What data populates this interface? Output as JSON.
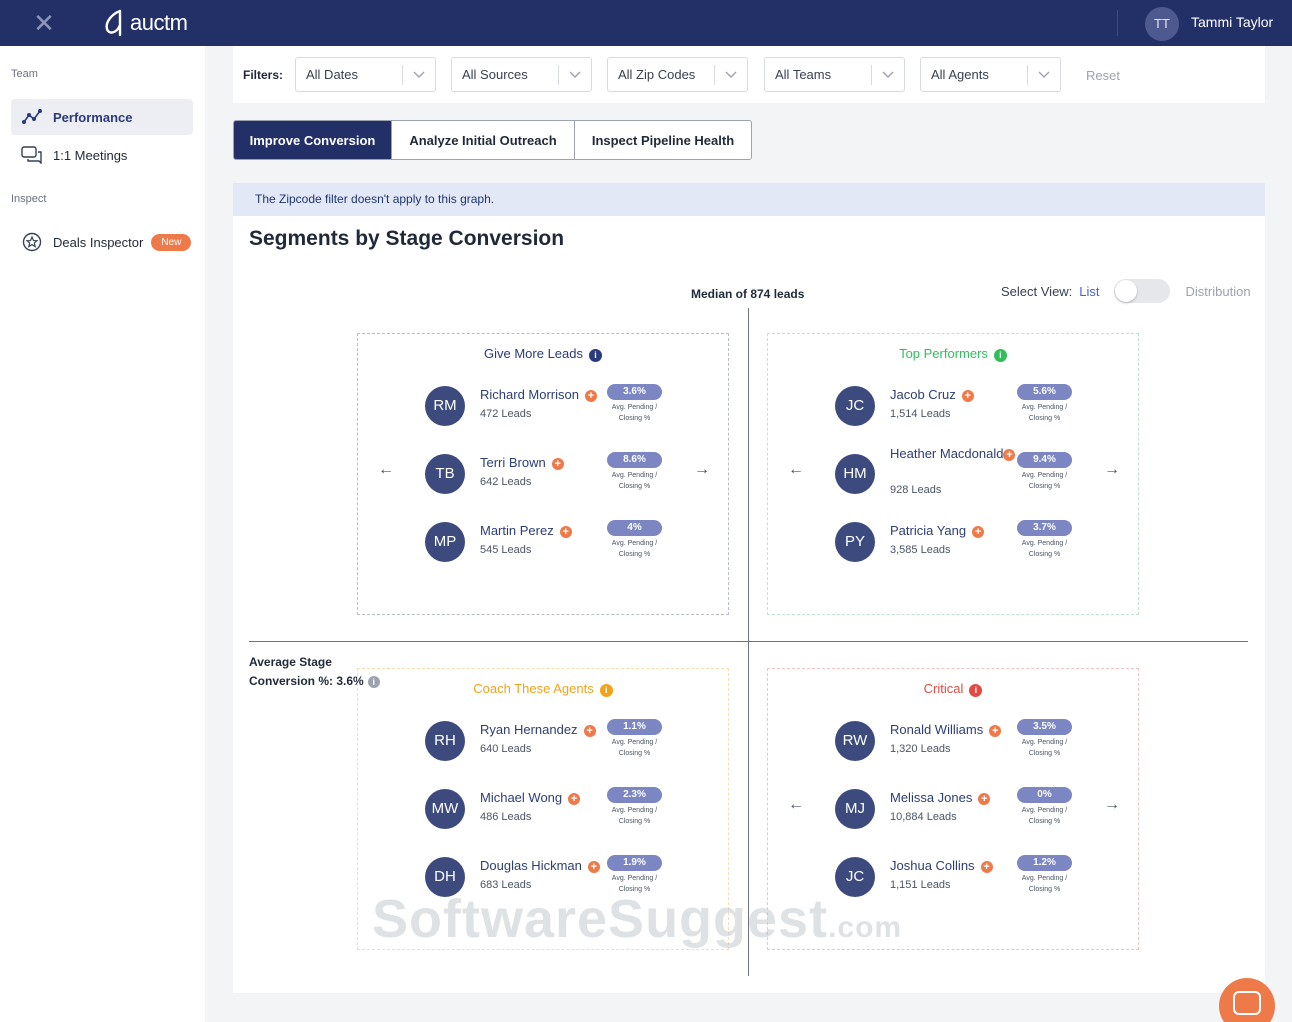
{
  "topbar": {
    "logo_text": "auctm",
    "user_initials": "TT",
    "user_name": "Tammi Taylor"
  },
  "sidebar": {
    "section_team": "Team",
    "section_inspect": "Inspect",
    "items": [
      {
        "label": "Performance"
      },
      {
        "label": "1:1 Meetings"
      },
      {
        "label": "Deals Inspector",
        "badge": "New"
      }
    ]
  },
  "filters": {
    "label": "Filters:",
    "selects": [
      "All Dates",
      "All Sources",
      "All Zip Codes",
      "All Teams",
      "All Agents"
    ],
    "reset": "Reset"
  },
  "tabs": [
    "Improve Conversion",
    "Analyze Initial Outreach",
    "Inspect Pipeline Health"
  ],
  "notice": "The Zipcode filter doesn't apply to this graph.",
  "graph": {
    "title": "Segments by Stage Conversion",
    "median_label": "Median of 874 leads",
    "select_view_label": "Select View:",
    "view_list": "List",
    "view_distribution": "Distribution",
    "avg_label_line1": "Average Stage",
    "avg_label_line2": "Conversion %: 3.6%",
    "pct_caption_line1": "Avg. Pending /",
    "pct_caption_line2": "Closing %",
    "quadrants": [
      {
        "title": "Give More Leads",
        "color": "#2a3a7a",
        "agents": [
          {
            "initials": "RM",
            "name": "Richard Morrison",
            "leads": "472 Leads",
            "pct": "3.6%"
          },
          {
            "initials": "TB",
            "name": "Terri Brown",
            "leads": "642 Leads",
            "pct": "8.6%"
          },
          {
            "initials": "MP",
            "name": "Martin Perez",
            "leads": "545 Leads",
            "pct": "4%"
          }
        ]
      },
      {
        "title": "Top Performers",
        "color": "#2fbf5a",
        "agents": [
          {
            "initials": "JC",
            "name": "Jacob Cruz",
            "leads": "1,514 Leads",
            "pct": "5.6%"
          },
          {
            "initials": "HM",
            "name": "Heather Macdonald",
            "leads": "928 Leads",
            "pct": "9.4%"
          },
          {
            "initials": "PY",
            "name": "Patricia Yang",
            "leads": "3,585 Leads",
            "pct": "3.7%"
          }
        ]
      },
      {
        "title": "Coach These Agents",
        "color": "#f2a31a",
        "agents": [
          {
            "initials": "RH",
            "name": "Ryan Hernandez",
            "leads": "640 Leads",
            "pct": "1.1%"
          },
          {
            "initials": "MW",
            "name": "Michael Wong",
            "leads": "486 Leads",
            "pct": "2.3%"
          },
          {
            "initials": "DH",
            "name": "Douglas Hickman",
            "leads": "683 Leads",
            "pct": "1.9%"
          }
        ]
      },
      {
        "title": "Critical",
        "color": "#e24b45",
        "agents": [
          {
            "initials": "RW",
            "name": "Ronald Williams",
            "leads": "1,320 Leads",
            "pct": "3.5%"
          },
          {
            "initials": "MJ",
            "name": "Melissa Jones",
            "leads": "10,884 Leads",
            "pct": "0%"
          },
          {
            "initials": "JC",
            "name": "Joshua Collins",
            "leads": "1,151 Leads",
            "pct": "1.2%"
          }
        ]
      }
    ]
  },
  "watermark": {
    "main": "SoftwareSuggest",
    "suffix": ".com"
  },
  "icons": {
    "close": "close-icon",
    "performance": "performance-chart-icon",
    "meetings": "chat-bubbles-icon",
    "deals": "star-circle-icon",
    "chevron": "chevron-down-icon",
    "info": "info-icon",
    "add": "add-icon",
    "arrow_left": "arrow-left-icon",
    "arrow_right": "arrow-right-icon",
    "chat": "chat-widget-icon"
  }
}
